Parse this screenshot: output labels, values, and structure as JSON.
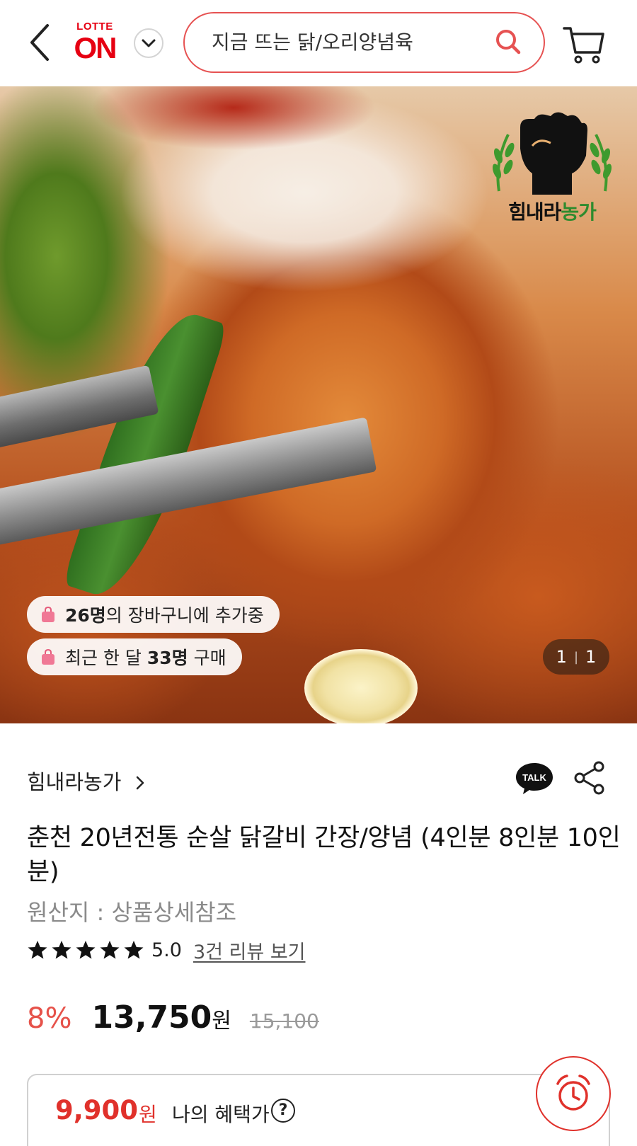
{
  "header": {
    "logo_top": "LOTTE",
    "logo_main": "ON",
    "search_text": "지금 뜨는 닭/오리양념육"
  },
  "hero": {
    "brand_logo_text_black": "힘내라",
    "brand_logo_text_green": "농가",
    "cart_count_num": "26명",
    "cart_count_text": "의 장바구니에 추가중",
    "recent_prefix": "최근 한 달 ",
    "recent_num": "33명",
    "recent_suffix": " 구매",
    "counter_current": "1",
    "counter_total": "1"
  },
  "product": {
    "seller": "힘내라농가",
    "title": "춘천 20년전통 순살 닭갈비 간장/양념 (4인분 8인분 10인분)",
    "origin": "원산지 : 상품상세참조",
    "rating": "5.0",
    "stars_filled": 5,
    "review_link": "3건 리뷰 보기",
    "discount": "8%",
    "price": "13,750",
    "price_unit": "원",
    "original_price": "15,100"
  },
  "benefit": {
    "price": "9,900",
    "unit": "원",
    "label": "나의 혜택가",
    "help": "?"
  },
  "colors": {
    "brand_red": "#e60012",
    "search_border": "#e65252",
    "discount": "#e6524a",
    "benefit_red": "#e0312b",
    "logo_green": "#2e8b2e"
  },
  "icons": [
    "back-icon",
    "chevron-down-icon",
    "search-icon",
    "cart-icon",
    "shopping-bag-icon",
    "kakao-talk-icon",
    "share-icon",
    "star-icon",
    "help-icon",
    "alarm-clock-icon"
  ]
}
